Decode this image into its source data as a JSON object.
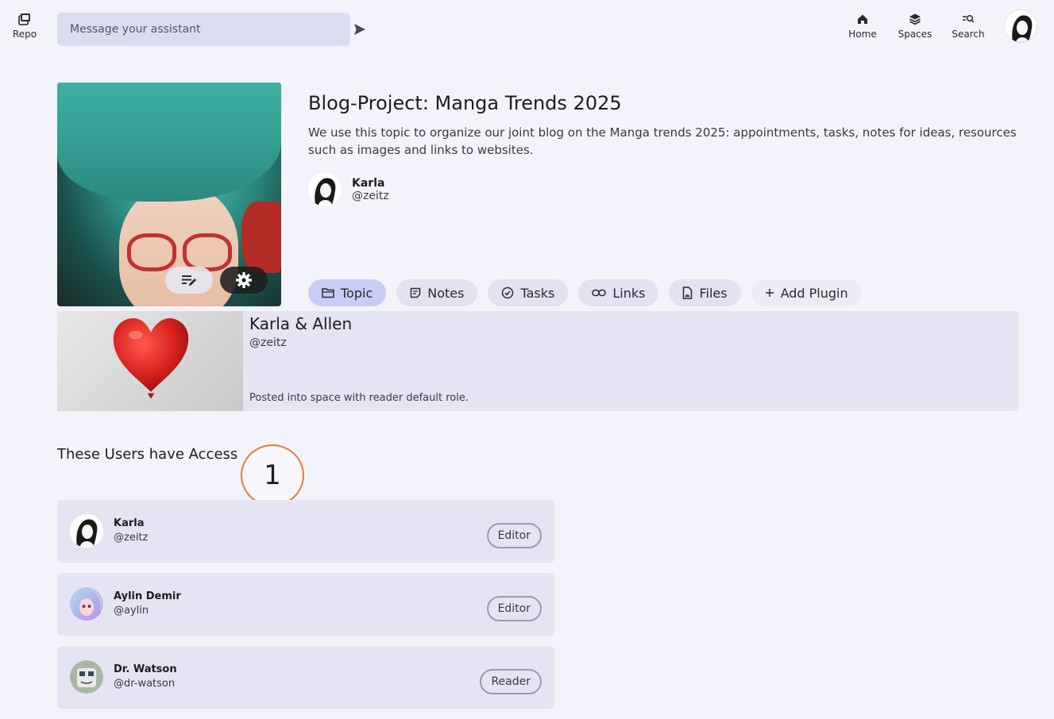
{
  "topbar": {
    "repo_label": "Repo",
    "assistant_placeholder": "Message your assistant",
    "nav": [
      {
        "label": "Home",
        "icon": "home-icon"
      },
      {
        "label": "Spaces",
        "icon": "layers-icon"
      },
      {
        "label": "Search",
        "icon": "search-icon"
      }
    ]
  },
  "topic": {
    "title": "Blog-Project: Manga Trends 2025",
    "description": "We use this topic to organize our joint blog on the Manga trends 2025: appointments, tasks, notes for ideas, resources such as images and links to websites.",
    "owner_name": "Karla",
    "owner_handle": "@zeitz"
  },
  "tabs": [
    {
      "label": "Topic",
      "icon": "folder-icon"
    },
    {
      "label": "Notes",
      "icon": "note-icon"
    },
    {
      "label": "Tasks",
      "icon": "check-circle-icon"
    },
    {
      "label": "Links",
      "icon": "link-icon"
    },
    {
      "label": "Files",
      "icon": "file-icon"
    },
    {
      "label": "Add Plugin",
      "icon": "plus-icon"
    }
  ],
  "post": {
    "title": "Karla & Allen",
    "handle": "@zeitz",
    "note": "Posted into space with reader default role."
  },
  "access": {
    "title": "These Users have Access",
    "marker": "1",
    "users": [
      {
        "name": "Karla",
        "handle": "@zeitz",
        "role": "Editor"
      },
      {
        "name": "Aylin Demir",
        "handle": "@aylin",
        "role": "Editor"
      },
      {
        "name": "Dr. Watson",
        "handle": "@dr-watson",
        "role": "Reader"
      }
    ]
  },
  "colors": {
    "background": "#f3f3fb",
    "card": "#e4e4f3",
    "active_tab": "#c9cdf6",
    "marker_ring": "#e07e3c",
    "balloon": "#d9211f"
  }
}
